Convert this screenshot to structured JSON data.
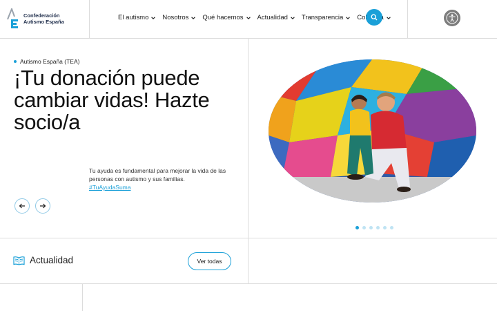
{
  "header": {
    "logo_line1": "Confederación",
    "logo_line2": "Autismo España",
    "nav": [
      {
        "label": "El autismo"
      },
      {
        "label": "Nosotros"
      },
      {
        "label": "Qué hacemos"
      },
      {
        "label": "Actualidad"
      },
      {
        "label": "Transparencia"
      },
      {
        "label": "Colabora"
      }
    ]
  },
  "hero": {
    "eyebrow": "Autismo España (TEA)",
    "title": "¡Tu donación puede cambiar vidas! Hazte socio/a",
    "description": "Tu ayuda es fundamental para mejorar la vida de las personas con autismo y sus familias.",
    "hashtag": "#TuAyudaSuma",
    "slides_total": 6,
    "active_slide": 1
  },
  "news": {
    "label": "Actualidad",
    "button": "Ver todas"
  },
  "colors": {
    "accent": "#1aa0d8",
    "access": "#7d7d7d",
    "border": "#dcdcdc"
  }
}
